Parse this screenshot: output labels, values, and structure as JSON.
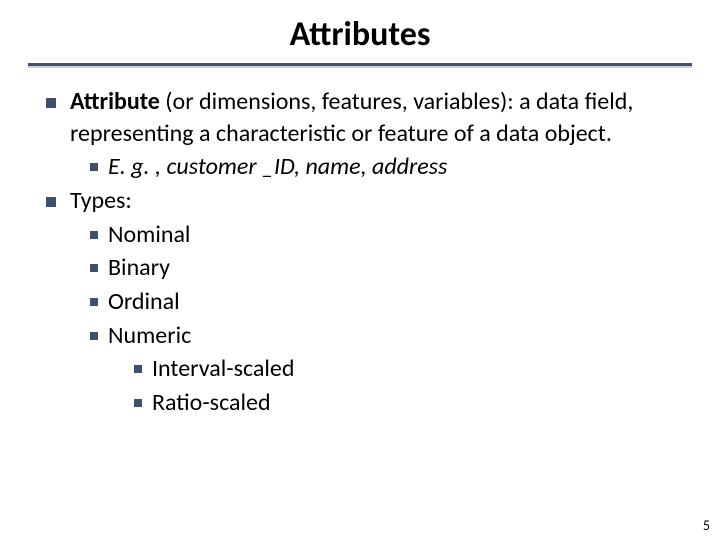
{
  "title": "Attributes",
  "points": {
    "p1_bold": "Attribute ",
    "p1_rest": "(or dimensions, features, variables): a data field, representing a characteristic or feature of a data object.",
    "p1_sub_eg": "E. g. , customer _ID, name, address",
    "p2": "Types:",
    "p2_sub1": "Nominal",
    "p2_sub2": "Binary",
    "p2_sub3": "Ordinal",
    "p2_sub4": "Numeric",
    "p2_sub4_a": "Interval-scaled",
    "p2_sub4_b": "Ratio-scaled"
  },
  "page_number": "5"
}
